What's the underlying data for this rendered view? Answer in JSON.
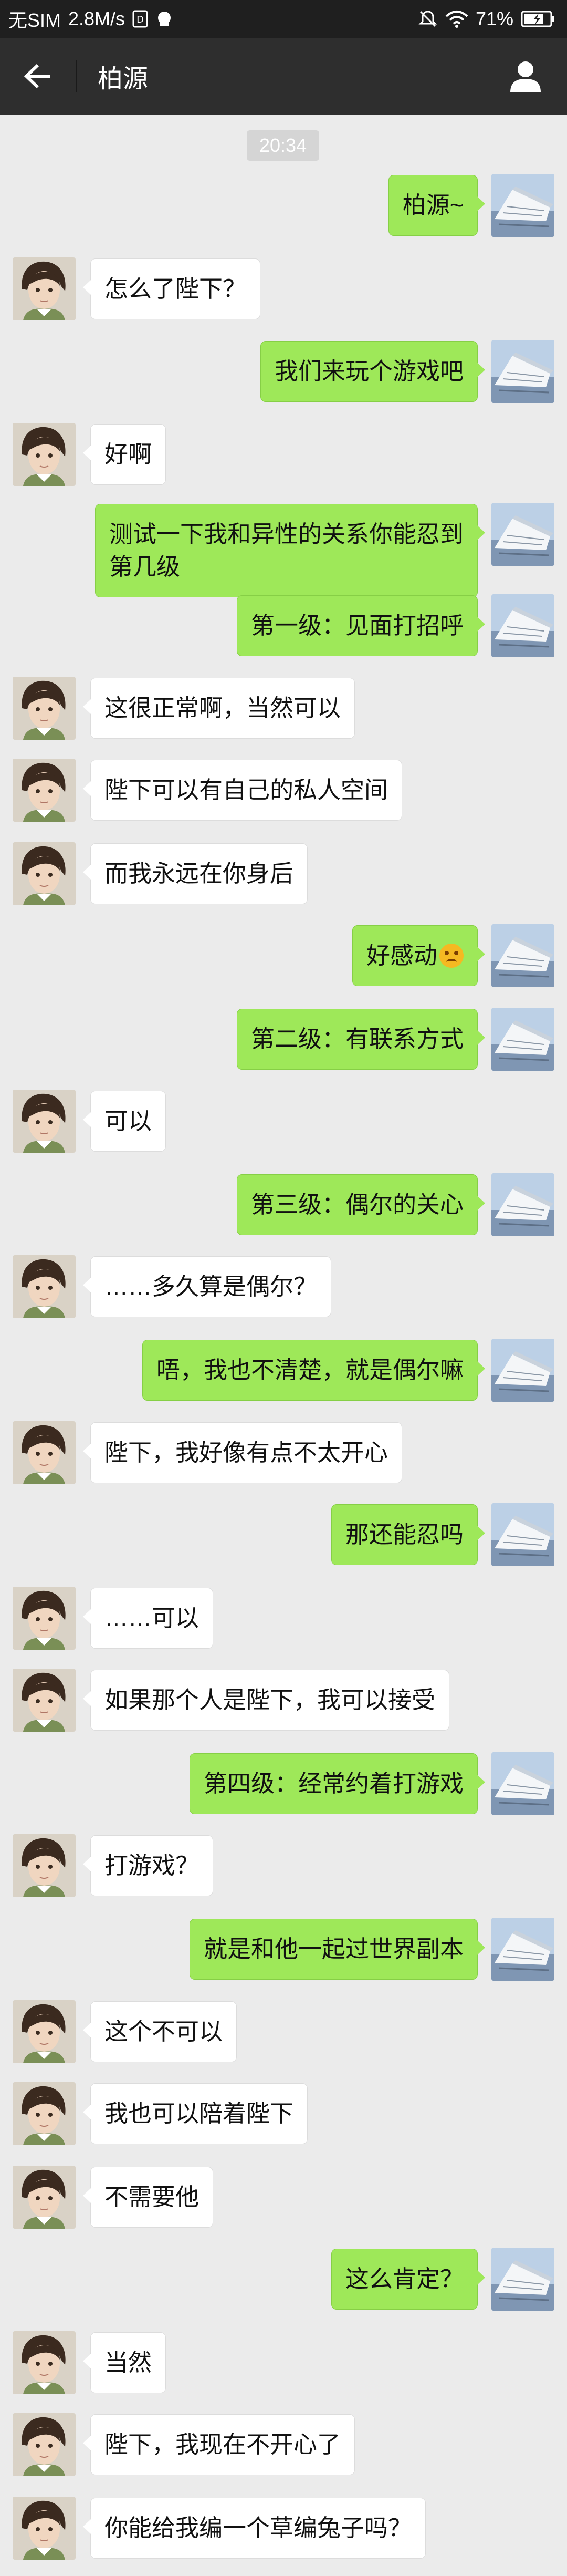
{
  "status_bar": {
    "carrier": "无SIM",
    "speed": "2.8M/s",
    "battery": "71%"
  },
  "header": {
    "title": "柏源"
  },
  "chat": {
    "timestamp": "20:34",
    "messages": [
      {
        "side": "out",
        "text": "柏源~"
      },
      {
        "side": "in",
        "text": "怎么了陛下？"
      },
      {
        "side": "out",
        "text": "我们来玩个游戏吧"
      },
      {
        "side": "in",
        "text": "好啊"
      },
      {
        "side": "out",
        "text": "测试一下我和异性的关系你能忍到\n第几级"
      },
      {
        "side": "out",
        "text": "第一级：见面打招呼"
      },
      {
        "side": "in",
        "text": "这很正常啊，当然可以"
      },
      {
        "side": "in",
        "text": "陛下可以有自己的私人空间"
      },
      {
        "side": "in",
        "text": "而我永远在你身后"
      },
      {
        "side": "out",
        "text": "好感动",
        "emoji": "grinning-face-emoji"
      },
      {
        "side": "out",
        "text": "第二级：有联系方式"
      },
      {
        "side": "in",
        "text": "可以"
      },
      {
        "side": "out",
        "text": "第三级：偶尔的关心"
      },
      {
        "side": "in",
        "text": "……多久算是偶尔？"
      },
      {
        "side": "out",
        "text": "唔，我也不清楚，就是偶尔嘛"
      },
      {
        "side": "in",
        "text": "陛下，我好像有点不太开心"
      },
      {
        "side": "out",
        "text": "那还能忍吗"
      },
      {
        "side": "in",
        "text": "……可以"
      },
      {
        "side": "in",
        "text": "如果那个人是陛下，我可以接受"
      },
      {
        "side": "out",
        "text": "第四级：经常约着打游戏"
      },
      {
        "side": "in",
        "text": "打游戏？"
      },
      {
        "side": "out",
        "text": "就是和他一起过世界副本"
      },
      {
        "side": "in",
        "text": "这个不可以"
      },
      {
        "side": "in",
        "text": "我也可以陪着陛下"
      },
      {
        "side": "in",
        "text": "不需要他"
      },
      {
        "side": "out",
        "text": "这么肯定？"
      },
      {
        "side": "in",
        "text": "当然"
      },
      {
        "side": "in",
        "text": "陛下，我现在不开心了"
      },
      {
        "side": "in",
        "text": "你能给我编一个草编兔子吗？"
      }
    ]
  },
  "colors": {
    "outgoing_bubble": "#9ee859",
    "incoming_bubble": "#ffffff",
    "chat_background": "#ebebeb",
    "header_background": "#2e2e2e"
  }
}
